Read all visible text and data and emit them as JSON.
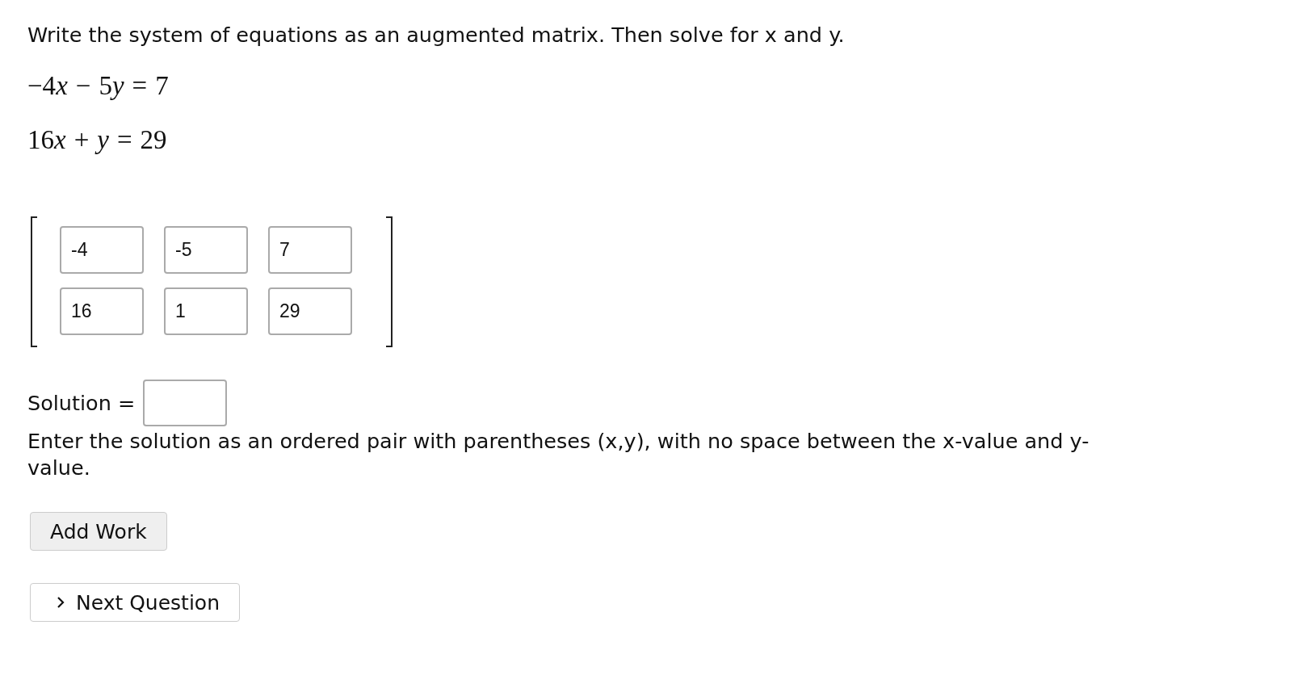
{
  "instruction": "Write the system of equations as an augmented matrix. Then solve for x and y.",
  "equations": [
    [
      {
        "kind": "num",
        "text": "−4"
      },
      {
        "kind": "var",
        "text": "x"
      },
      {
        "kind": "op",
        "text": "−"
      },
      {
        "kind": "num",
        "text": "5"
      },
      {
        "kind": "var",
        "text": "y"
      },
      {
        "kind": "op",
        "text": "="
      },
      {
        "kind": "num",
        "text": "7"
      }
    ],
    [
      {
        "kind": "num",
        "text": "16"
      },
      {
        "kind": "var",
        "text": "x"
      },
      {
        "kind": "op",
        "text": "+"
      },
      {
        "kind": "var",
        "text": "y"
      },
      {
        "kind": "op",
        "text": "="
      },
      {
        "kind": "num",
        "text": "29"
      }
    ]
  ],
  "matrix": {
    "rows": [
      [
        "-4",
        "-5",
        "7"
      ],
      [
        "16",
        "1",
        "29"
      ]
    ]
  },
  "solution": {
    "label": "Solution =",
    "hint": "Enter the solution as an ordered pair with parentheses (x,y), with no space between the x-value and y-value."
  },
  "buttons": [
    {
      "kind": "plain",
      "label": "Add Work"
    },
    {
      "kind": "next",
      "label": "Next Question"
    }
  ]
}
